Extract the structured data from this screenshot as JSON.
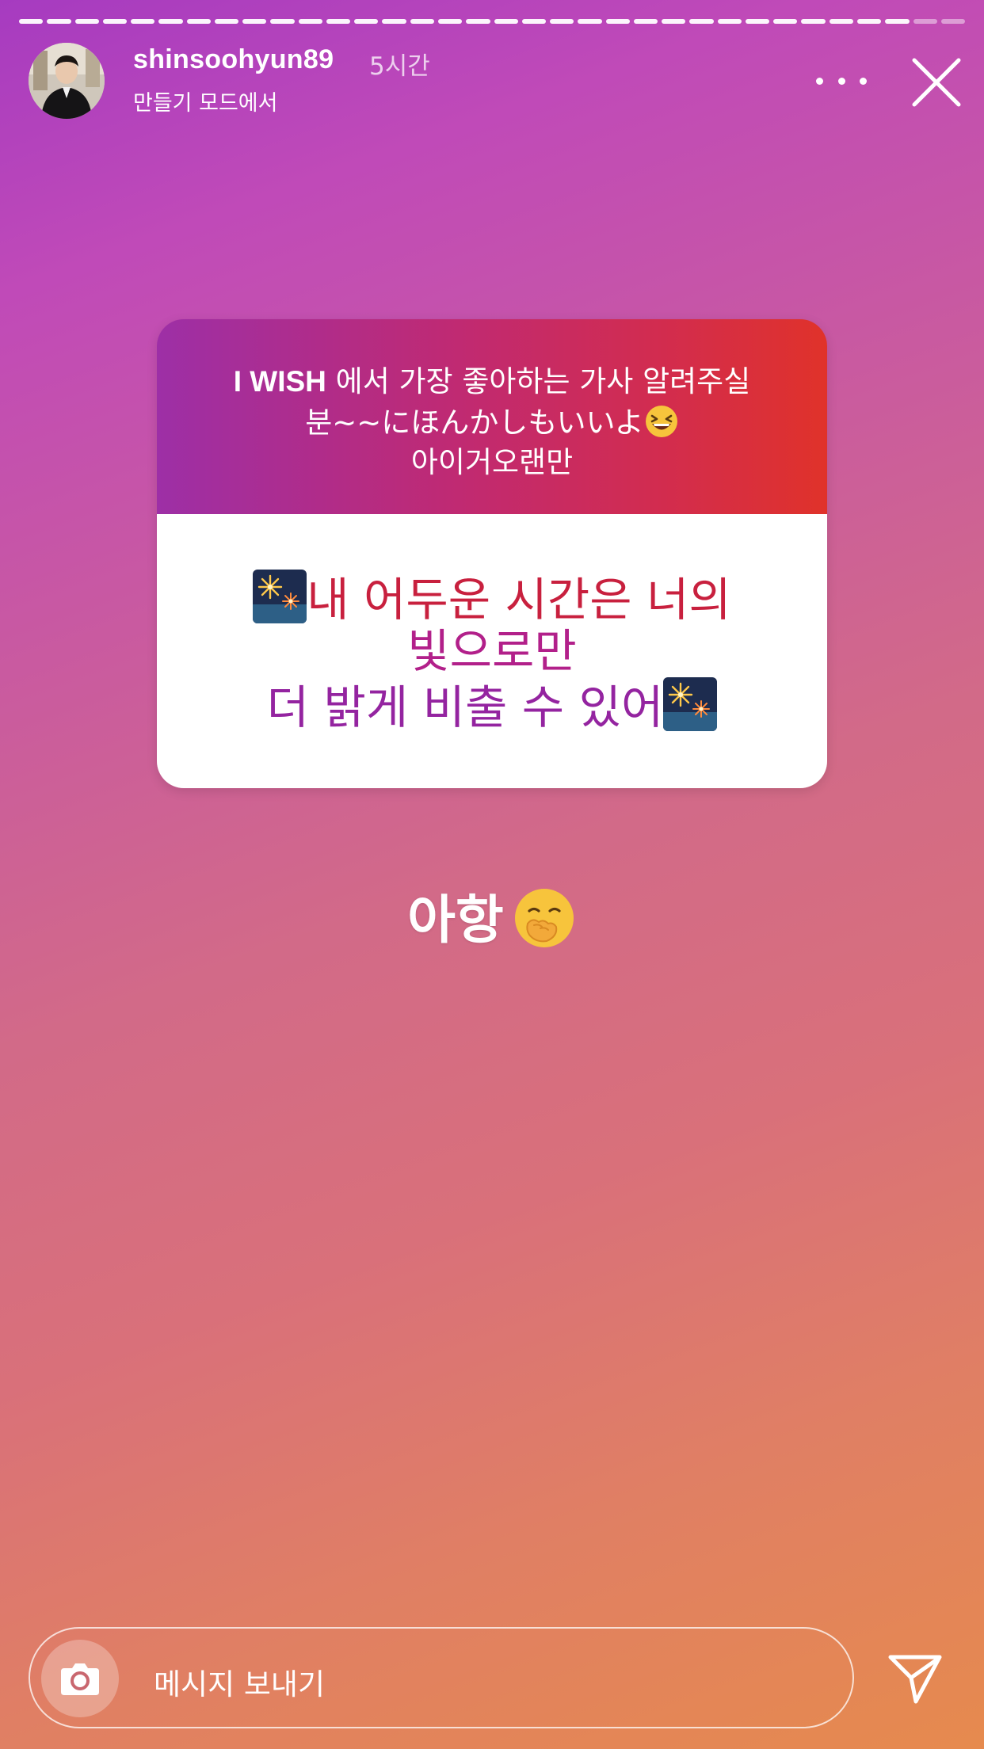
{
  "story": {
    "segment_count": 34,
    "current_segment": 32,
    "username": "shinsoohyun89",
    "time_ago": "5시간",
    "subtitle": "만들기 모드에서",
    "background_gradient": [
      "#a63bc0",
      "#c95aa0",
      "#d9707a",
      "#e68a4e"
    ]
  },
  "header": {
    "more_icon": "more-dots-icon",
    "close_icon": "close-icon",
    "avatar_icon": "profile-avatar"
  },
  "question_sticker": {
    "question_line1_latin": "I WISH",
    "question_line1_rest": " 에서 가장 좋아하는 가사 알려주실",
    "question_line2": "분~~にほんかしもいいよ",
    "question_line2_emoji": "laughing-face-emoji",
    "question_line3": "아이거오랜만",
    "answer_line1": "내 어두운 시간은 너의",
    "answer_line2": "빛으로만",
    "answer_line3": "더 밝게 비출 수 있어",
    "answer_emoji": "fireworks-emoji",
    "header_gradient": [
      "#9d2fa6",
      "#c02a72",
      "#e0322a"
    ],
    "answer_colors": [
      "#c8203e",
      "#b2208a",
      "#9424a0"
    ]
  },
  "caption": {
    "text": "아항",
    "emoji": "hand-over-mouth-emoji"
  },
  "reply": {
    "placeholder": "메시지 보내기",
    "camera_icon": "camera-icon",
    "send_icon": "send-icon"
  }
}
